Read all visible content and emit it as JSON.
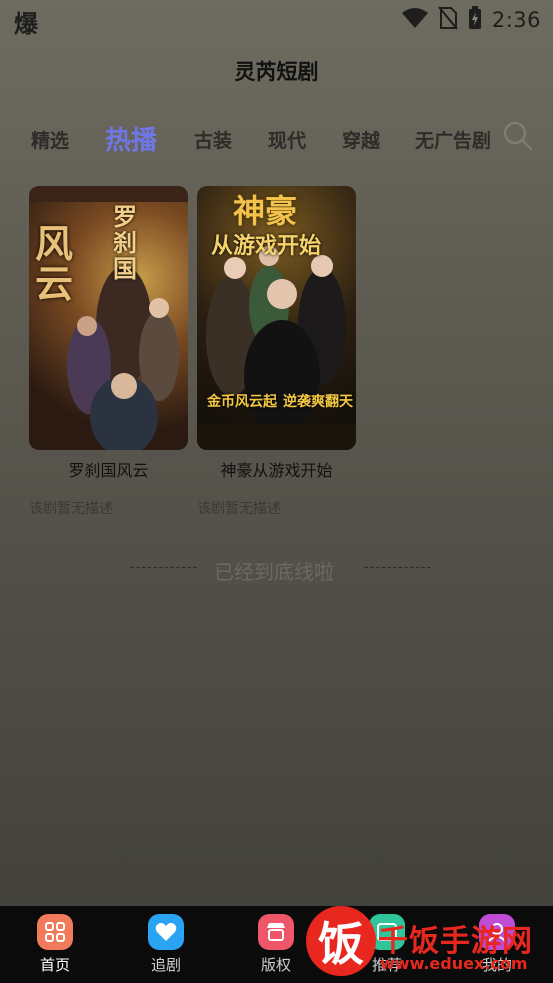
{
  "status_bar": {
    "left_glyph": "爆",
    "time": "2:36",
    "icons": [
      "wifi-icon",
      "no-sim-icon",
      "battery-charging-icon"
    ]
  },
  "header": {
    "title": "灵芮短剧"
  },
  "tabs": [
    {
      "label": "精选",
      "active": false
    },
    {
      "label": "热播",
      "active": true
    },
    {
      "label": "古装",
      "active": false
    },
    {
      "label": "现代",
      "active": false
    },
    {
      "label": "穿越",
      "active": false
    },
    {
      "label": "无广告剧",
      "active": false
    }
  ],
  "search": {
    "icon": "search-icon"
  },
  "dramas": [
    {
      "title": "罗刹国风云",
      "description": "该剧暂无描述",
      "poster_text_big": "风云",
      "poster_text_top": "罗刹国"
    },
    {
      "title": "神豪从游戏开始",
      "description": "该剧暂无描述",
      "poster_text_top": "神豪",
      "poster_text_sub": "从游戏开始",
      "poster_bottom_left": "金币风云起",
      "poster_bottom_right": "逆袭爽翻天"
    }
  ],
  "list_end": {
    "dash": "------------",
    "text": "已经到底线啦"
  },
  "bottom_nav": [
    {
      "label": "首页",
      "icon": "home-grid-icon",
      "color": "#f07a5a",
      "active": true
    },
    {
      "label": "追剧",
      "icon": "heart-icon",
      "color": "#2aa3f2",
      "active": false
    },
    {
      "label": "版权",
      "icon": "store-icon",
      "color": "#f0566a",
      "active": false
    },
    {
      "label": "推荐",
      "icon": "recommend-icon",
      "color": "#2fc49a",
      "active": false
    },
    {
      "label": "我的",
      "icon": "profile-icon",
      "color": "#c04bd6",
      "active": false
    }
  ],
  "watermark": {
    "badge": "饭",
    "text": "千饭手游网",
    "url": "www.eduex.com"
  },
  "colors": {
    "accent": "#6f77e6",
    "background_top": "#6e6b60",
    "background_bottom": "#3f3e39",
    "nav_background": "#0b0b0b"
  }
}
